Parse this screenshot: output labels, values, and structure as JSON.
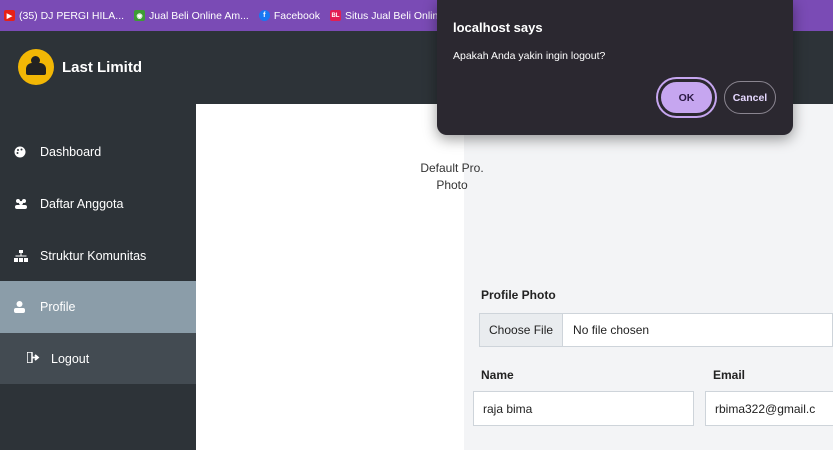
{
  "bookmarks": [
    {
      "label": "(35) DJ PERGI HILA...",
      "icon": "youtube-icon",
      "color": "#e62117",
      "glyph": "▶"
    },
    {
      "label": "Jual Beli Online Am...",
      "icon": "shop-icon",
      "color": "#3e9c35",
      "glyph": "◉"
    },
    {
      "label": "Facebook",
      "icon": "facebook-icon",
      "color": "#1877f2",
      "glyph": "f"
    },
    {
      "label": "Situs Jual Beli Onlin...",
      "icon": "bukalapak-icon",
      "color": "#e31e52",
      "glyph": "BL"
    }
  ],
  "header": {
    "brand": "Last Limitd"
  },
  "sidebar": {
    "items": [
      {
        "label": "Dashboard",
        "icon": "palette-icon"
      },
      {
        "label": "Daftar Anggota",
        "icon": "users-icon"
      },
      {
        "label": "Struktur Komunitas",
        "icon": "sitemap-icon"
      },
      {
        "label": "Profile",
        "icon": "user-icon"
      }
    ],
    "logout": {
      "label": "Logout",
      "icon": "sign-out-icon"
    }
  },
  "profile": {
    "photo_alt_line1": "Default Pro.",
    "photo_alt_line2": "Photo",
    "photo_label": "Profile Photo",
    "file_button": "Choose File",
    "file_status": "No file chosen",
    "name_label": "Name",
    "name_value": "raja bima",
    "email_label": "Email",
    "email_value": "rbima322@gmail.c"
  },
  "dialog": {
    "title": "localhost says",
    "message": "Apakah Anda yakin ingin logout?",
    "ok_label": "OK",
    "cancel_label": "Cancel"
  },
  "colors": {
    "bookmarks_bar": "#7a4bb5",
    "header": "#2d3338",
    "sidebar_active": "#8b9da9",
    "dialog_bg": "#2b2830",
    "ok_button": "#c6a6f0"
  }
}
